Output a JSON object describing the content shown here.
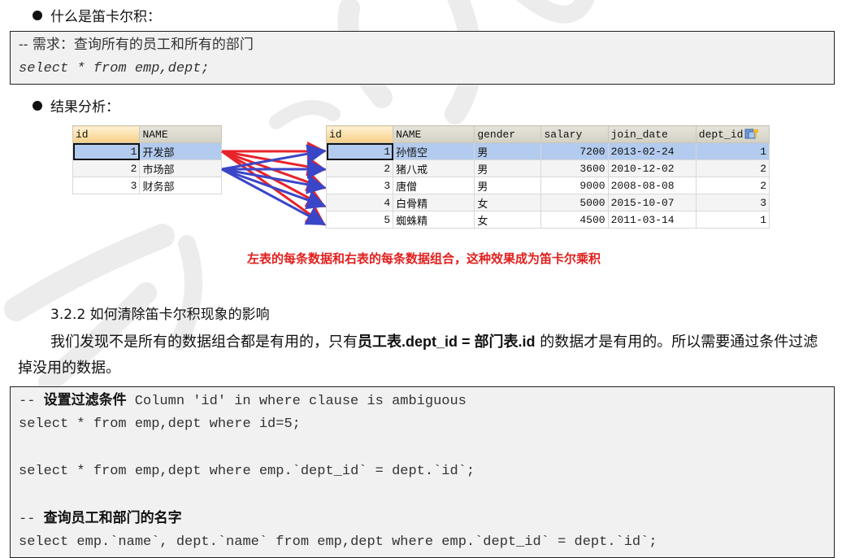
{
  "section1": {
    "bullet_text": "什么是笛卡尔积：",
    "code": {
      "comment": "-- 需求：查询所有的员工和所有的部门",
      "sql": "select * from emp,dept;"
    }
  },
  "section2": {
    "bullet_text": "结果分析：",
    "dept_table": {
      "columns": [
        "id",
        "NAME"
      ],
      "rows": [
        [
          "1",
          "开发部"
        ],
        [
          "2",
          "市场部"
        ],
        [
          "3",
          "财务部"
        ]
      ],
      "selected_row": 0
    },
    "emp_table": {
      "columns": [
        "id",
        "NAME",
        "gender",
        "salary",
        "join_date",
        "dept_id"
      ],
      "rows": [
        [
          "1",
          "孙悟空",
          "男",
          "7200",
          "2013-02-24",
          "1"
        ],
        [
          "2",
          "猪八戒",
          "男",
          "3600",
          "2010-12-02",
          "2"
        ],
        [
          "3",
          "唐僧",
          "男",
          "9000",
          "2008-08-08",
          "2"
        ],
        [
          "4",
          "白骨精",
          "女",
          "5000",
          "2015-10-07",
          "3"
        ],
        [
          "5",
          "蜘蛛精",
          "女",
          "4500",
          "2011-03-14",
          "1"
        ]
      ],
      "selected_row": 0,
      "header_icon": "column-sort-icon"
    },
    "arrows": {
      "colors": {
        "dept_1": "#e8232a",
        "dept_2": "#3a46c8"
      },
      "mapping": "each dept row to every emp row"
    },
    "caption": "左表的每条数据和右表的每条数据组合，这种效果成为笛卡尔乘积"
  },
  "section3": {
    "heading": "3.2.2 如何清除笛卡尔积现象的影响",
    "para": {
      "part1": "我们发现不是所有的数据组合都是有用的，只有",
      "bold1": "员工表.dept_id = 部门表.id",
      "part2": " 的数据才是有用的。所以需要通过条件过滤掉没用的数据。"
    },
    "code": {
      "comment1_prefix": "-- ",
      "comment1_cjk": "设置过滤条件",
      "comment1_rest": " Column 'id' in where clause is ambiguous",
      "sql1": "select * from emp,dept where id=5;",
      "blank1": "",
      "sql2": "select * from emp,dept where emp.`dept_id` = dept.`id`;",
      "blank2": "",
      "comment2_prefix": "-- ",
      "comment2_cjk": "查询员工和部门的名字",
      "sql3": "select emp.`name`, dept.`name` from emp,dept where emp.`dept_id` = dept.`id`;"
    }
  },
  "colors": {
    "code_bg": "#f1f1f1",
    "caption": "#e0201e",
    "selected_row": "#b3cbee"
  }
}
